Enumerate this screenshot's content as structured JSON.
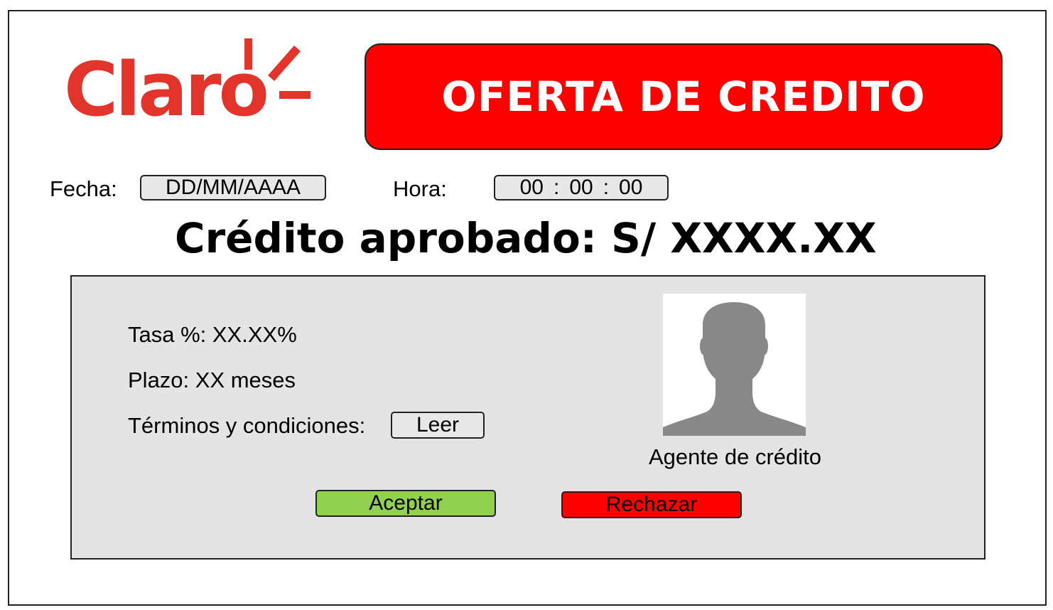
{
  "brand": {
    "logo_text": "Claro",
    "logo_color": "#e2342a"
  },
  "header": {
    "title": "OFERTA DE CREDITO",
    "banner_color": "#ff0000"
  },
  "datetime": {
    "date_label": "Fecha:",
    "date_value": "DD/MM/AAAA",
    "time_label": "Hora:",
    "time_hours": "00",
    "time_minutes": "00",
    "time_seconds": "00",
    "time_separator": ":"
  },
  "approved": {
    "text": "Crédito aprobado: S/ XXXX.XX"
  },
  "details": {
    "rate": "Tasa %: XX.XX%",
    "term": "Plazo: XX meses",
    "terms_label": "Términos y condiciones:",
    "read_button": "Leer"
  },
  "agent": {
    "caption": "Agente de crédito",
    "avatar_icon": "person-silhouette-icon"
  },
  "actions": {
    "accept_label": "Aceptar",
    "accept_color": "#92d050",
    "reject_label": "Rechazar",
    "reject_color": "#ff0000"
  }
}
